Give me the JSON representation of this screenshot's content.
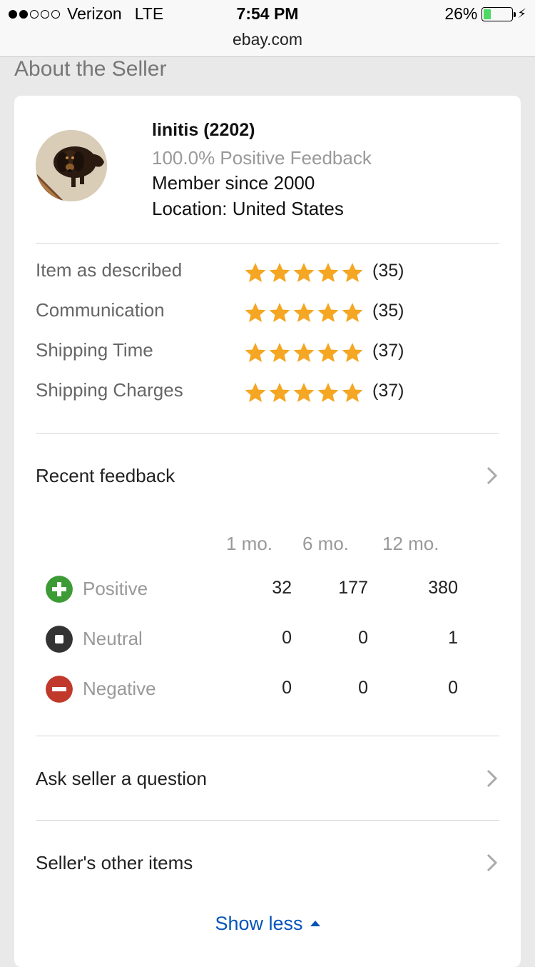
{
  "status": {
    "carrier": "Verizon",
    "network": "LTE",
    "time": "7:54 PM",
    "battery": "26%",
    "battery_level": 0.26,
    "url": "ebay.com"
  },
  "section_title": "About the Seller",
  "seller": {
    "name": "linitis (2202)",
    "feedback": "100.0% Positive Feedback",
    "member_since": "Member since 2000",
    "location": "Location: United States"
  },
  "ratings": [
    {
      "label": "Item as described",
      "count": "(35)",
      "stars": 5
    },
    {
      "label": "Communication",
      "count": "(35)",
      "stars": 5
    },
    {
      "label": "Shipping Time",
      "count": "(37)",
      "stars": 5
    },
    {
      "label": "Shipping Charges",
      "count": "(37)",
      "stars": 5
    }
  ],
  "recent_feedback": {
    "label": "Recent feedback",
    "periods": [
      "1 mo.",
      "6 mo.",
      "12 mo."
    ],
    "rows": [
      {
        "label": "Positive",
        "values": [
          "32",
          "177",
          "380"
        ]
      },
      {
        "label": "Neutral",
        "values": [
          "0",
          "0",
          "1"
        ]
      },
      {
        "label": "Negative",
        "values": [
          "0",
          "0",
          "0"
        ]
      }
    ]
  },
  "links": {
    "ask": "Ask seller a question",
    "other_items": "Seller's other items",
    "show_less": "Show less"
  },
  "colors": {
    "star": "#f5a623",
    "positive": "#3d9b35",
    "neutral": "#333333",
    "negative": "#c0392b",
    "link": "#0654ba"
  }
}
